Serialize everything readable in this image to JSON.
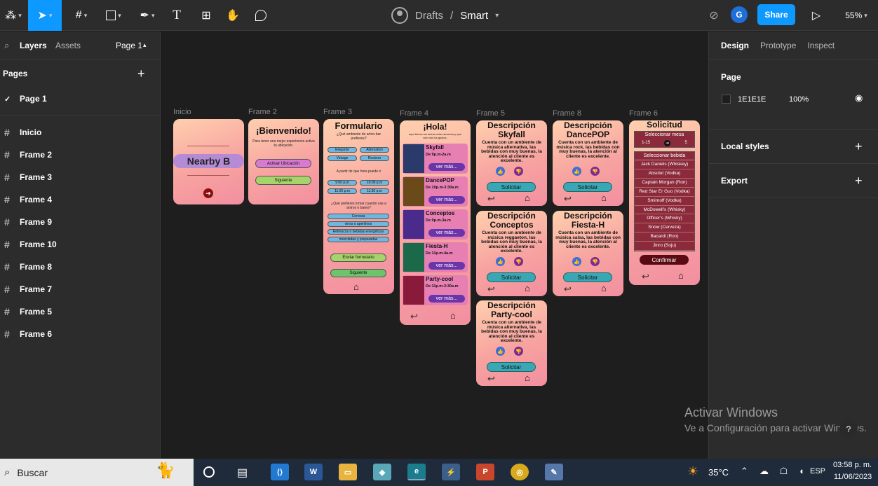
{
  "toolbar": {
    "file_owner": "Drafts",
    "separator": "/",
    "file_name": "Smart",
    "user_initial": "G",
    "share_label": "Share",
    "zoom": "55%"
  },
  "left_panel": {
    "tabs": [
      "Layers",
      "Assets"
    ],
    "page_selector": "Page 1",
    "pages_title": "Pages",
    "current_page": "Page 1",
    "layers": [
      "Inicio",
      "Frame 2",
      "Frame 3",
      "Frame 4",
      "Frame 9",
      "Frame 10",
      "Frame 8",
      "Frame 7",
      "Frame 5",
      "Frame 6"
    ]
  },
  "right_panel": {
    "tabs": [
      "Design",
      "Prototype",
      "Inspect"
    ],
    "page_label": "Page",
    "bg_hex": "1E1E1E",
    "bg_opacity": "100%",
    "local_styles": "Local styles",
    "export": "Export"
  },
  "canvas": {
    "labels": {
      "inicio": "Inicio",
      "f2": "Frame 2",
      "f3": "Frame 3",
      "f4": "Frame 4",
      "f5": "Frame 5",
      "f8": "Frame 8",
      "f6": "Frame 6"
    },
    "inicio": {
      "title": "Nearby B"
    },
    "frame2": {
      "title": "¡Bienvenido!",
      "subtitle": "Para tener una mejor experiencia activa tu ubicación.",
      "activate": "Activar Ubicación",
      "next": "Siguiente"
    },
    "frame3": {
      "title": "Formulario",
      "q1": "¿Qué ambiente de antro-bar prefieres?",
      "opts1": [
        "Elegante",
        "Alternativo",
        "Vintage",
        "Rockero"
      ],
      "q2": "A partir de que hora puede ir",
      "opts2": [
        "9:00 p.m",
        "10:00 p.m",
        "11:00 p.m",
        "11:30 p.m"
      ],
      "q3": "¿Qué prefieres tomar cuando vas a antros o bares?",
      "opts3": [
        "Cerveza",
        "vinos o aperitivos",
        "Refrescos o bebidas energéticas",
        "mezcladas y preparadas"
      ],
      "submit": "Enviar formulario",
      "next": "Siguiente"
    },
    "frame4": {
      "title": "¡Hola!",
      "subtitle": "aquí tienes los antros más cercanos y que van con tus gustos.",
      "items": [
        {
          "name": "Skyfall",
          "hours": "De 9p.m-2a.m",
          "more": "ver más..."
        },
        {
          "name": "DancePOP",
          "hours": "De 10p.m-3:30a.m",
          "more": "ver más..."
        },
        {
          "name": "Conceptos",
          "hours": "De 9p.m-3a.m",
          "more": "ver más..."
        },
        {
          "name": "Fiesta-H",
          "hours": "De 11p.m-4a.m",
          "more": "ver más..."
        },
        {
          "name": "Party-cool",
          "hours": "De 11p.m-3:30a.m",
          "more": "ver más..."
        }
      ]
    },
    "desc_frames": [
      {
        "heading": "Descripción",
        "name": "Skyfall",
        "text": "Cuenta con un ambiente de música alternativa, las bebidas con muy buenas, la atención al cliente es excelente.",
        "cta": "Solicitar"
      },
      {
        "heading": "Descripción",
        "name": "DancePOP",
        "text": "Cuenta con un ambiente de música rock, las bebidas con muy buenas, la atención al cliente es excelente.",
        "cta": "Solicitar"
      },
      {
        "heading": "Descripción",
        "name": "Conceptos",
        "text": "Cuenta con un ambiente de música reggaeton, las bebidas con muy buenas, la atención al cliente es excelente.",
        "cta": "Solicitar"
      },
      {
        "heading": "Descripción",
        "name": "Fiesta-H",
        "text": "Cuenta con un ambiente de música salsa, las bebidas con muy buenas, la atención al cliente es excelente.",
        "cta": "Solicitar"
      },
      {
        "heading": "Descripción",
        "name": "Party-cool",
        "text": "Cuenta con un ambiente de música alternativa, las bebidas con muy buenas, la atención al cliente es excelente.",
        "cta": "Solicitar"
      }
    ],
    "frame6": {
      "title": "Solicitud",
      "table_label": "Seleccionar mesa",
      "range": "1-15",
      "selected": "5",
      "drink_label": "Seleccionar bebida",
      "drinks": [
        "Jack Daniels (Whiskey)",
        "Absolut (Vodka)",
        "Captain Morgan (Ron)",
        "Red Star Er Guo (Vodka)",
        "Smirnoff (Vodka)",
        "McDowell's (Whisky)",
        "Officer's (Whisky)",
        "Snow (Cerveza)",
        "Bacardi (Ron)",
        "Jinro (Soju)"
      ],
      "confirm": "Confirmar"
    }
  },
  "watermark": {
    "title": "Activar Windows",
    "subtitle": "Ve a Configuración para activar Windows."
  },
  "taskbar": {
    "search": "Buscar",
    "temp": "35°C",
    "lang": "ESP",
    "time": "03:58 p. m.",
    "date": "11/06/2023"
  },
  "colors": {
    "accent": "#0d99ff",
    "panel": "#2c2c2c",
    "canvas": "#1e1e1e"
  }
}
